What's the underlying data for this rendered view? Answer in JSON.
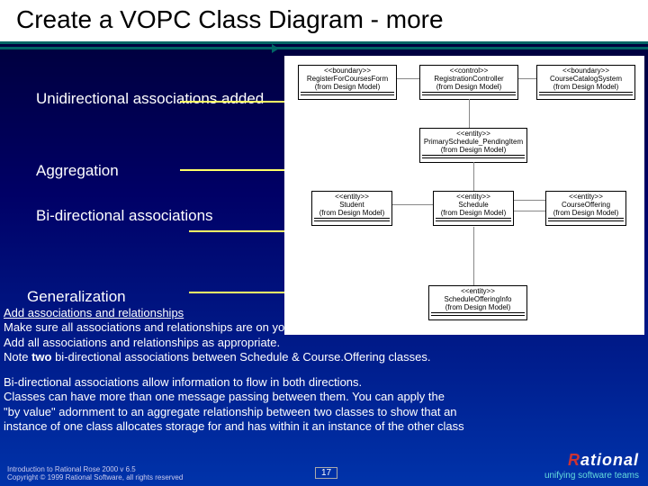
{
  "title": "Create a VOPC Class Diagram - more",
  "labels": {
    "unidir": "Unidirectional associations added",
    "aggreg": "Aggregation",
    "bidir": "Bi-directional associations",
    "general": "Generalization"
  },
  "classes": {
    "c1": {
      "stereo": "<<boundary>>",
      "name": "RegisterForCoursesForm",
      "from": "(from Design Model)"
    },
    "c2": {
      "stereo": "<<control>>",
      "name": "RegistrationController",
      "from": "(from Design Model)"
    },
    "c3": {
      "stereo": "<<boundary>>",
      "name": "CourseCatalogSystem",
      "from": "(from Design Model)"
    },
    "c4": {
      "stereo": "<<entity>>",
      "name": "PrimarySchedule_PendingItem",
      "from": "(from Design Model)"
    },
    "c5": {
      "stereo": "<<entity>>",
      "name": "Student",
      "from": "(from Design Model)"
    },
    "c6": {
      "stereo": "<<entity>>",
      "name": "Schedule",
      "from": "(from Design Model)"
    },
    "c7": {
      "stereo": "<<entity>>",
      "name": "CourseOffering",
      "from": "(from Design Model)"
    },
    "c8": {
      "stereo": "<<entity>>",
      "name": "ScheduleOfferingInfo",
      "from": "(from Design Model)"
    }
  },
  "body": {
    "h1": "Add associations and relationships",
    "l1": "Make sure all associations and relationships are on your toolbar. (IF not, add them)",
    "l2": "Add all associations and relationships as appropriate.",
    "l3a": "Note ",
    "l3b": "two",
    "l3c": " bi-directional associations between Schedule & Course.Offering classes.",
    "p2a": "Bi-directional associations allow information to flow in both directions.",
    "p2b": " Classes can have more than one message passing between them. You can apply the",
    "p2c": " \"by value\" adornment to an aggregate relationship between two classes to show that an",
    "p2d": " instance of one class allocates storage for and has within it an instance of the other class"
  },
  "footer": {
    "l1": "Introduction to Rational Rose 2000 v 6.5",
    "l2": "Copyright © 1999 Rational Software, all rights reserved"
  },
  "slide_number": "17",
  "logo": {
    "brand_r": "R",
    "brand_rest": "ational",
    "tagline": "unifying software teams"
  }
}
